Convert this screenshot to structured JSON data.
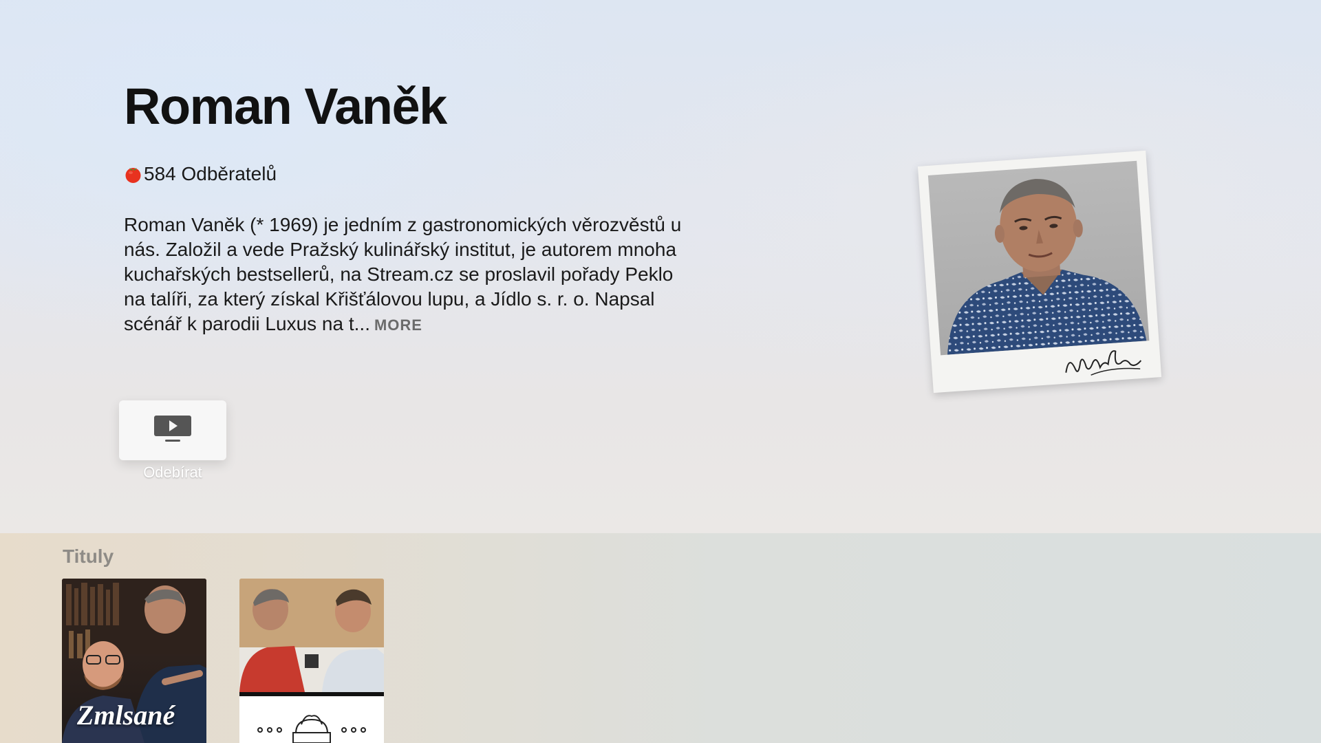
{
  "profile": {
    "name": "Roman Vaněk",
    "subscribers": "584 Odběratelů",
    "description": "Roman Vaněk (* 1969) je jedním z gastronomických věrozvěstů u nás. Založil a vede Pražský kulinářský institut, je autorem mnoha kuchařských bestsellerů, na Stream.cz se proslavil pořady Peklo na talíři, za který získal Křišťálovou lupu, a Jídlo s. r. o. Napsal scénář k parodii Luxus na t...",
    "more_label": "MORE",
    "subscribe_icon": "tv-play-icon",
    "subscribe_label": "Odebírat",
    "photo_icon": "portrait-photo"
  },
  "titles_section": {
    "label": "Tituly",
    "items": [
      {
        "title_text": "Zmlsané",
        "poster": "two-men-bookshelf-poster"
      },
      {
        "poster": "two-men-kitchen-poster"
      }
    ]
  },
  "colors": {
    "accent_tomato": "#e8321f",
    "section_label": "#8e8b86"
  }
}
